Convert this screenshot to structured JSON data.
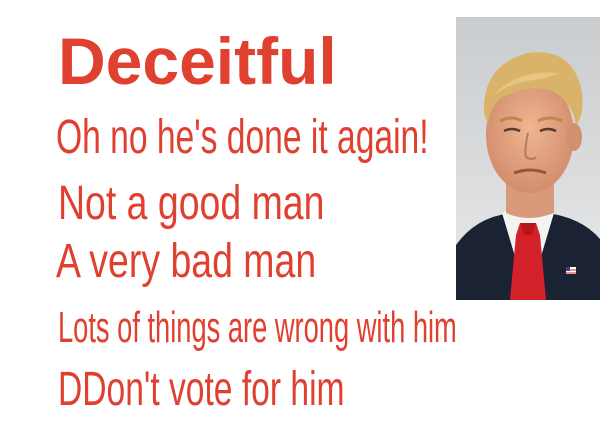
{
  "meme": {
    "lines": [
      "Deceitful",
      "Oh no he's done it again!",
      "Not a good man",
      "A very bad man",
      "Lots of things are wrong with him",
      "DDon't vote for him"
    ]
  },
  "colors": {
    "text": "#e0402f",
    "background": "#ffffff",
    "tie": "#d3222a",
    "suit": "#1b2233",
    "hair": "#d9b36a",
    "skin": "#e8a98a"
  },
  "photo": {
    "icon": "portrait-photo"
  }
}
